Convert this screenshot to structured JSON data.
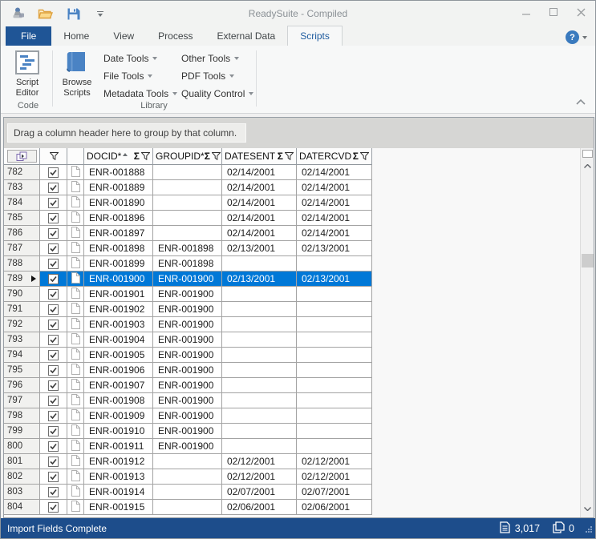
{
  "window": {
    "title": "ReadySuite - Compiled"
  },
  "icons": {
    "qat": [
      "app-stamp-icon",
      "open-folder-icon",
      "save-icon",
      "qat-dropdown-icon"
    ],
    "titlebar": [
      "minimize-icon",
      "maximize-icon",
      "close-icon"
    ],
    "tabrow": [
      "help-icon"
    ],
    "grid_header": [
      "grid-customize-icon",
      "filter-funnel-icon",
      "sum-icon",
      "sort-asc-icon"
    ],
    "statusbar": [
      "document-count-icon",
      "page-count-icon",
      "resize-grip-icon"
    ]
  },
  "colors": {
    "file_tab_bg": "#1f5596",
    "selected_tab_text": "#1e5b9e",
    "selection_blue": "#0078d7",
    "statusbar_bg": "#1d4d8b",
    "ribbon_icon_blue": "#4a83c4"
  },
  "tabs": [
    {
      "label": "File"
    },
    {
      "label": "Home"
    },
    {
      "label": "View"
    },
    {
      "label": "Process"
    },
    {
      "label": "External Data"
    },
    {
      "label": "Scripts"
    }
  ],
  "ribbon": {
    "code": {
      "label": "Code",
      "script_editor": "Script Editor"
    },
    "library": {
      "label": "Library",
      "browse_scripts": "Browse Scripts",
      "menus": [
        "Date Tools",
        "File Tools",
        "Metadata Tools",
        "Other Tools",
        "PDF Tools",
        "Quality Control"
      ]
    }
  },
  "group_panel": {
    "text": "Drag a column header here to group by that column."
  },
  "grid": {
    "columns": [
      {
        "label": "DOCID*",
        "sort": "asc"
      },
      {
        "label": "GROUPID*",
        "sort": ""
      },
      {
        "label": "DATESENT",
        "sort": ""
      },
      {
        "label": "DATERCVD",
        "sort": ""
      }
    ],
    "rows": [
      {
        "num": "782",
        "checked": true,
        "docid": "ENR-001888",
        "groupid": "",
        "datesent": "02/14/2001",
        "datercvd": "02/14/2001",
        "selected": false
      },
      {
        "num": "783",
        "checked": true,
        "docid": "ENR-001889",
        "groupid": "",
        "datesent": "02/14/2001",
        "datercvd": "02/14/2001",
        "selected": false
      },
      {
        "num": "784",
        "checked": true,
        "docid": "ENR-001890",
        "groupid": "",
        "datesent": "02/14/2001",
        "datercvd": "02/14/2001",
        "selected": false
      },
      {
        "num": "785",
        "checked": true,
        "docid": "ENR-001896",
        "groupid": "",
        "datesent": "02/14/2001",
        "datercvd": "02/14/2001",
        "selected": false
      },
      {
        "num": "786",
        "checked": true,
        "docid": "ENR-001897",
        "groupid": "",
        "datesent": "02/14/2001",
        "datercvd": "02/14/2001",
        "selected": false
      },
      {
        "num": "787",
        "checked": true,
        "docid": "ENR-001898",
        "groupid": "ENR-001898",
        "datesent": "02/13/2001",
        "datercvd": "02/13/2001",
        "selected": false
      },
      {
        "num": "788",
        "checked": true,
        "docid": "ENR-001899",
        "groupid": "ENR-001898",
        "datesent": "",
        "datercvd": "",
        "selected": false
      },
      {
        "num": "789",
        "checked": true,
        "docid": "ENR-001900",
        "groupid": "ENR-001900",
        "datesent": "02/13/2001",
        "datercvd": "02/13/2001",
        "selected": true
      },
      {
        "num": "790",
        "checked": true,
        "docid": "ENR-001901",
        "groupid": "ENR-001900",
        "datesent": "",
        "datercvd": "",
        "selected": false
      },
      {
        "num": "791",
        "checked": true,
        "docid": "ENR-001902",
        "groupid": "ENR-001900",
        "datesent": "",
        "datercvd": "",
        "selected": false
      },
      {
        "num": "792",
        "checked": true,
        "docid": "ENR-001903",
        "groupid": "ENR-001900",
        "datesent": "",
        "datercvd": "",
        "selected": false
      },
      {
        "num": "793",
        "checked": true,
        "docid": "ENR-001904",
        "groupid": "ENR-001900",
        "datesent": "",
        "datercvd": "",
        "selected": false
      },
      {
        "num": "794",
        "checked": true,
        "docid": "ENR-001905",
        "groupid": "ENR-001900",
        "datesent": "",
        "datercvd": "",
        "selected": false
      },
      {
        "num": "795",
        "checked": true,
        "docid": "ENR-001906",
        "groupid": "ENR-001900",
        "datesent": "",
        "datercvd": "",
        "selected": false
      },
      {
        "num": "796",
        "checked": true,
        "docid": "ENR-001907",
        "groupid": "ENR-001900",
        "datesent": "",
        "datercvd": "",
        "selected": false
      },
      {
        "num": "797",
        "checked": true,
        "docid": "ENR-001908",
        "groupid": "ENR-001900",
        "datesent": "",
        "datercvd": "",
        "selected": false
      },
      {
        "num": "798",
        "checked": true,
        "docid": "ENR-001909",
        "groupid": "ENR-001900",
        "datesent": "",
        "datercvd": "",
        "selected": false
      },
      {
        "num": "799",
        "checked": true,
        "docid": "ENR-001910",
        "groupid": "ENR-001900",
        "datesent": "",
        "datercvd": "",
        "selected": false
      },
      {
        "num": "800",
        "checked": true,
        "docid": "ENR-001911",
        "groupid": "ENR-001900",
        "datesent": "",
        "datercvd": "",
        "selected": false
      },
      {
        "num": "801",
        "checked": true,
        "docid": "ENR-001912",
        "groupid": "",
        "datesent": "02/12/2001",
        "datercvd": "02/12/2001",
        "selected": false
      },
      {
        "num": "802",
        "checked": true,
        "docid": "ENR-001913",
        "groupid": "",
        "datesent": "02/12/2001",
        "datercvd": "02/12/2001",
        "selected": false
      },
      {
        "num": "803",
        "checked": true,
        "docid": "ENR-001914",
        "groupid": "",
        "datesent": "02/07/2001",
        "datercvd": "02/07/2001",
        "selected": false
      },
      {
        "num": "804",
        "checked": true,
        "docid": "ENR-001915",
        "groupid": "",
        "datesent": "02/06/2001",
        "datercvd": "02/06/2001",
        "selected": false
      }
    ]
  },
  "statusbar": {
    "message": "Import Fields Complete",
    "doc_count": "3,017",
    "page_count": "0"
  }
}
